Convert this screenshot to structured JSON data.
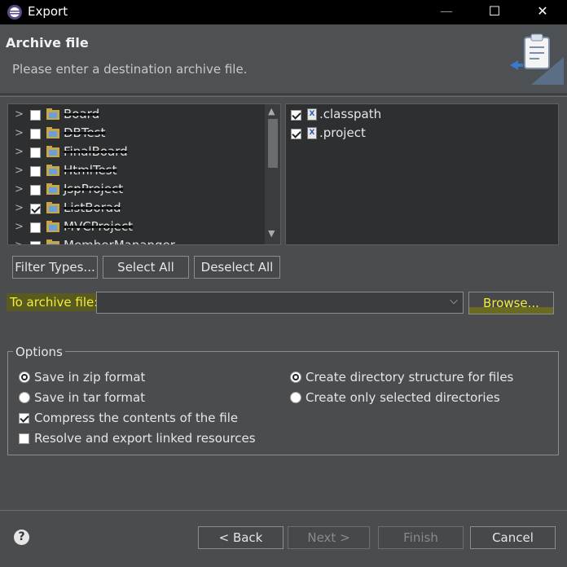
{
  "window": {
    "title": "Export",
    "minimize_glyph": "—",
    "maximize_glyph": "☐",
    "close_glyph": "✕"
  },
  "header": {
    "title": "Archive file",
    "subtitle": "Please enter a destination archive file."
  },
  "projects": [
    {
      "label": "Board",
      "checked": false
    },
    {
      "label": "DBTest",
      "checked": false
    },
    {
      "label": "FinalBoard",
      "checked": false
    },
    {
      "label": "HtmlTest",
      "checked": false
    },
    {
      "label": "JspProject",
      "checked": false
    },
    {
      "label": "ListBorad",
      "checked": true
    },
    {
      "label": "MVCProject",
      "checked": false
    },
    {
      "label": "MemberMananger",
      "checked": false
    }
  ],
  "files": [
    {
      "label": ".classpath",
      "checked": true
    },
    {
      "label": ".project",
      "checked": true
    }
  ],
  "selection_buttons": {
    "filter": "Filter Types...",
    "select_all": "Select All",
    "deselect_all": "Deselect All"
  },
  "archive": {
    "label": "To archive file:",
    "value": "",
    "browse": "Browse..."
  },
  "options": {
    "legend": "Options",
    "zip": {
      "label": "Save in zip format",
      "selected": true
    },
    "tar": {
      "label": "Save in tar format",
      "selected": false
    },
    "compress": {
      "label": "Compress the contents of the file",
      "checked": true
    },
    "resolve": {
      "label": "Resolve and export linked resources",
      "checked": false
    },
    "dir_structure": {
      "label": "Create directory structure for files",
      "selected": true
    },
    "only_selected": {
      "label": "Create only selected directories",
      "selected": false
    }
  },
  "footer": {
    "help": "?",
    "back": "< Back",
    "next": "Next >",
    "finish": "Finish",
    "cancel": "Cancel"
  },
  "colors": {
    "highlight": "#f4ec3a",
    "background": "#4a4c4e",
    "panel": "#2d2f31"
  }
}
